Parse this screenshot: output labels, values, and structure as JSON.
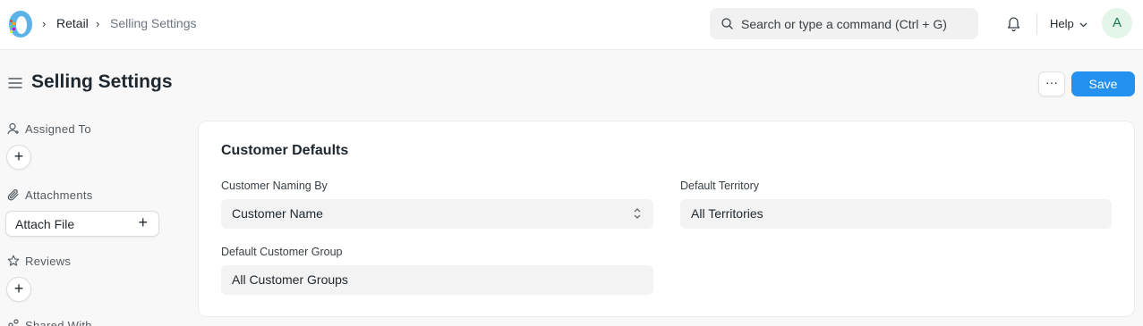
{
  "navbar": {
    "breadcrumbs": [
      {
        "label": "Retail"
      },
      {
        "label": "Selling Settings"
      }
    ],
    "search": {
      "placeholder": "Search or type a command (Ctrl + G)"
    },
    "help_label": "Help",
    "avatar_initial": "A"
  },
  "page": {
    "title": "Selling Settings",
    "more_label": "···",
    "save_label": "Save"
  },
  "sidebar": {
    "assigned_to": "Assigned To",
    "attachments": "Attachments",
    "attach_file": "Attach File",
    "reviews": "Reviews",
    "shared_with": "Shared With"
  },
  "form": {
    "section_title": "Customer Defaults",
    "fields": [
      {
        "label": "Customer Naming By",
        "value": "Customer Name"
      },
      {
        "label": "Default Territory",
        "value": "All Territories"
      },
      {
        "label": "Default Customer Group",
        "value": "All Customer Groups"
      }
    ]
  },
  "colors": {
    "primary": "#2490ef",
    "avatar_bg": "#e4f5e9",
    "avatar_text": "#16794c"
  }
}
